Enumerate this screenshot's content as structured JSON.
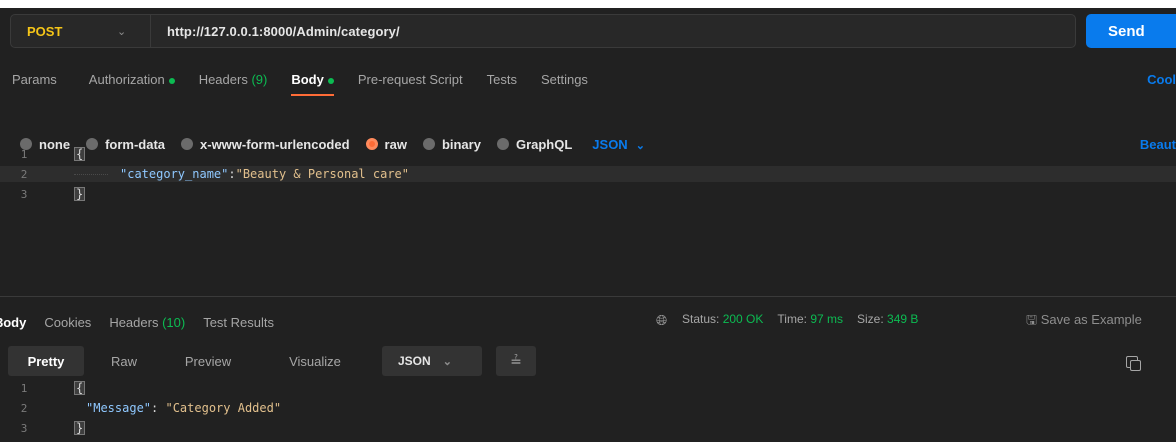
{
  "request": {
    "method": "POST",
    "url": "http://127.0.0.1:8000/Admin/category/",
    "send_label": "Send"
  },
  "request_tabs": [
    {
      "label": "Params"
    },
    {
      "label": "Authorization"
    },
    {
      "label": "Headers",
      "count": "(9)"
    },
    {
      "label": "Body"
    },
    {
      "label": "Pre-request Script"
    },
    {
      "label": "Tests"
    },
    {
      "label": "Settings"
    }
  ],
  "cookies_link": "Cool",
  "body_options": [
    "none",
    "form-data",
    "x-www-form-urlencoded",
    "raw",
    "binary",
    "GraphQL"
  ],
  "selected_body_option": "raw",
  "body_format": "JSON",
  "beautify_link": "Beaut",
  "request_body": {
    "line_numbers": [
      "1",
      "2",
      "3"
    ],
    "open_brace": "{",
    "close_brace": "}",
    "key": "\"category_name\"",
    "colon": ":",
    "value": "\"Beauty & Personal care\""
  },
  "response_tabs": [
    {
      "label": "3ody"
    },
    {
      "label": "Cookies"
    },
    {
      "label": "Headers",
      "count": "(10)"
    },
    {
      "label": "Test Results"
    }
  ],
  "response_status": {
    "status_label": "Status:",
    "status_value": "200 OK",
    "time_label": "Time:",
    "time_value": "97 ms",
    "size_label": "Size:",
    "size_value": "349 B"
  },
  "save_example": "Save as Example",
  "view_modes": [
    "Pretty",
    "Raw",
    "Preview",
    "Visualize"
  ],
  "response_format": "JSON",
  "response_body": {
    "line_numbers": [
      "1",
      "2",
      "3"
    ],
    "open_brace": "{",
    "close_brace": "}",
    "key": "\"Message\"",
    "colon": ": ",
    "value": "\"Category Added\""
  },
  "colors": {
    "accent": "#ff6c37",
    "primary": "#097bed",
    "success": "#0cbb52",
    "method": "#f5c518"
  }
}
